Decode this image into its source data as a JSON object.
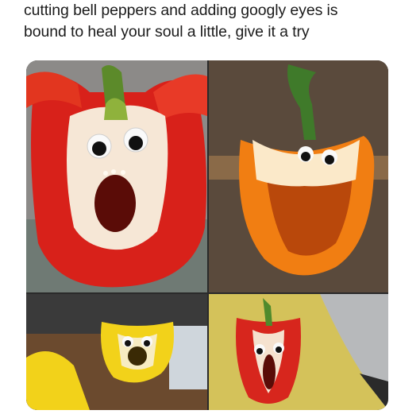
{
  "caption": {
    "line1": "cutting bell peppers and adding googly eyes is",
    "line2": "bound to heal your soul a little, give it a try"
  },
  "photos": [
    {
      "name": "red-pepper-face-photo",
      "pepper_color": "#d8211a"
    },
    {
      "name": "orange-pepper-face-photo",
      "pepper_color": "#f17e12"
    },
    {
      "name": "yellow-pepper-face-photo",
      "pepper_color": "#f2d21a"
    },
    {
      "name": "small-red-pepper-with-knife-photo",
      "pepper_color": "#d7261d"
    }
  ]
}
